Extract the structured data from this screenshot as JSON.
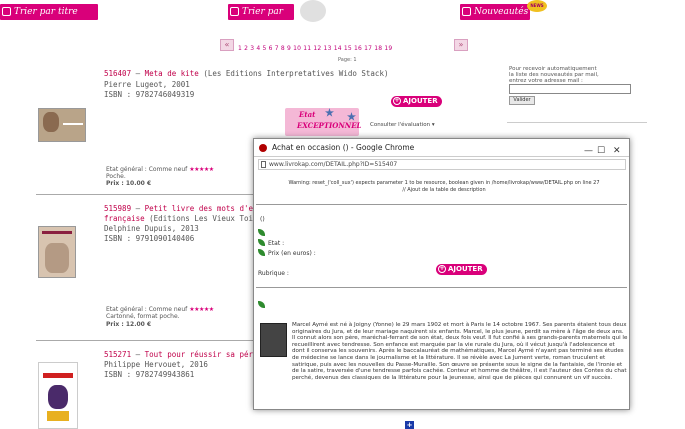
{
  "top_nav": {
    "sort_title": "Trier par titre",
    "sort_price": "Trier par prix",
    "new_items": "Nouveautés",
    "new_badge": "NEWS"
  },
  "pager": {
    "prev": "«",
    "next": "»",
    "pages": "1  2  3  4  5  6  7  8  9  10  11  12  13  14  15  16  17  18  19",
    "page_of": "Page: 1"
  },
  "books": [
    {
      "ref": "516407",
      "dash": " – ",
      "title": "Meta de kite",
      "publisher": " (Les Editions Interpretatives Wido Stack)",
      "author_year": "Pierre Lugeot, 2001",
      "isbn": "ISBN : 9782746049319",
      "state_label": "Etat général : Comme neuf",
      "stars": "★★★★★",
      "extra": "Poche.",
      "price_label": "Prix : ",
      "price": "10.00 €"
    },
    {
      "ref": "515989",
      "dash": " – ",
      "title": "Petit livre des mots d'esprit ou la",
      "title2": "française",
      "publisher": " (Editions Les Vieux Toiles)",
      "author_year": "Delphine Dupuis, 2013",
      "isbn": "ISBN : 9791090140406",
      "state_label": "Etat général : Comme neuf",
      "stars": "★★★★★",
      "extra": "Cartonné, format poche.",
      "price_label": "Prix : ",
      "price": "12.00 €"
    },
    {
      "ref": "515271",
      "dash": " – ",
      "title": "Tout pour réussir sa période décès",
      "author_year": "Philippe Hervouet, 2016",
      "isbn": "ISBN : 9782749943861"
    }
  ],
  "add_button": "AJOUTER",
  "etat": {
    "line1": "Etat",
    "line2": "EXCEPTIONNEL",
    "select": "Consulter l'évaluation ▾"
  },
  "sidebar": {
    "line1": "Pour recevoir automatiquement",
    "line2": "la liste des nouveautés par mail,",
    "line3": "entrez votre adresse mail :",
    "button": "Valider"
  },
  "popup": {
    "title": "Achat en occasion () - Google Chrome",
    "minimize": "—",
    "maximize": "☐",
    "close": "✕",
    "url": "www.livrokap.com/DETAIL.php?ID=515407",
    "warning1": "Warning: reset_('coll_sux') expects parameter 1 to be resource, boolean given in /home/livrokap/www/DETAIL.php on line 27",
    "warning2": "// Ajout de la table de description",
    "index": "()",
    "etat_label": "Etat :",
    "prix_label": "Prix (en euros) :",
    "rubrique_label": "Rubrique :",
    "bio": "Marcel Aymé est né à Joigny (Yonne) le 29 mars 1902 et mort à Paris le 14 octobre 1967. Ses parents étaient tous deux originaires du Jura, et de leur mariage naquirent six enfants. Marcel, le plus jeune, perdit sa mère à l'âge de deux ans. Il connut alors son père, maréchal-ferrant de son état, deux fois veuf. Il fut confié à ses grands-parents maternels qui le recueillirent avec tendresse. Son enfance est marquée par la vie rurale du Jura, où il vécut jusqu'à l'adolescence et dont il conserva les souvenirs. Après le baccalauréat de mathématiques, Marcel Aymé n'ayant pas terminé ses études de médecine se lance dans le journalisme et la littérature. Il se révèle avec La Jument verte, roman truculent et satirique, puis avec les nouvelles du Passe-Muraille. Son œuvre se présente sous le signe de la fantaisie, de l'ironie et de la satire, traversée d'une tendresse parfois cachée. Conteur et homme de théâtre, il est l'auteur des Contes du chat perché, devenus des classiques de la littérature pour la jeunesse, ainsi que de pièces qui connurent un vif succès."
  },
  "colors": {
    "accent_pink": "#d9007a",
    "title_red": "#c0004a",
    "leaf_green": "#2e8b2e",
    "chrome_red": "#b00000"
  }
}
